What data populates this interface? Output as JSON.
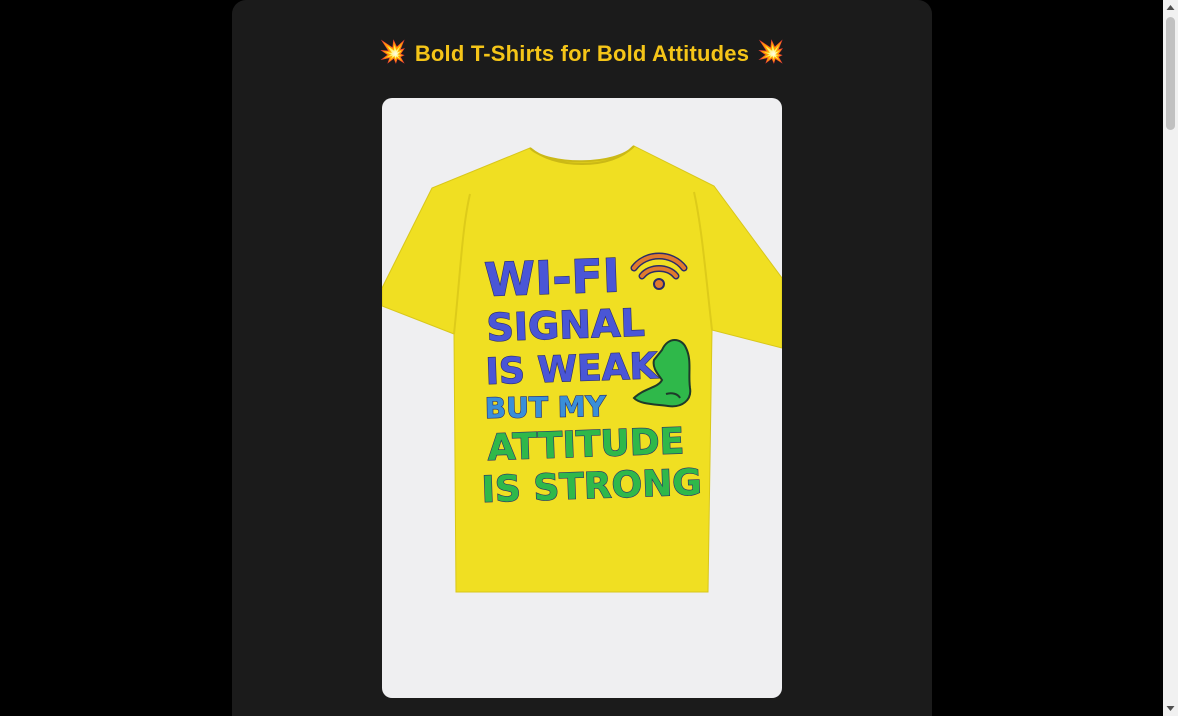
{
  "page": {
    "title": "Bold T-Shirts for Bold Attitudes",
    "title_emoji": "💥",
    "accent_color": "#f5c518",
    "background_color": "#000000",
    "card_color": "#1b1b1b"
  },
  "product": {
    "shirt_color": "#f0df22",
    "print_lines": [
      "WI-FI",
      "SIGNAL",
      "IS WEAK",
      "BUT MY",
      "ATTITUDE",
      "IS STRONG"
    ],
    "print_colors": {
      "blue": "#4a56d6",
      "green": "#2fb84a",
      "orange": "#e07a2e"
    },
    "icons": [
      "wifi-icon",
      "flexed-arm-icon"
    ]
  },
  "scrollbar": {
    "up_icon": "chevron-up-icon",
    "down_icon": "chevron-down-icon"
  }
}
